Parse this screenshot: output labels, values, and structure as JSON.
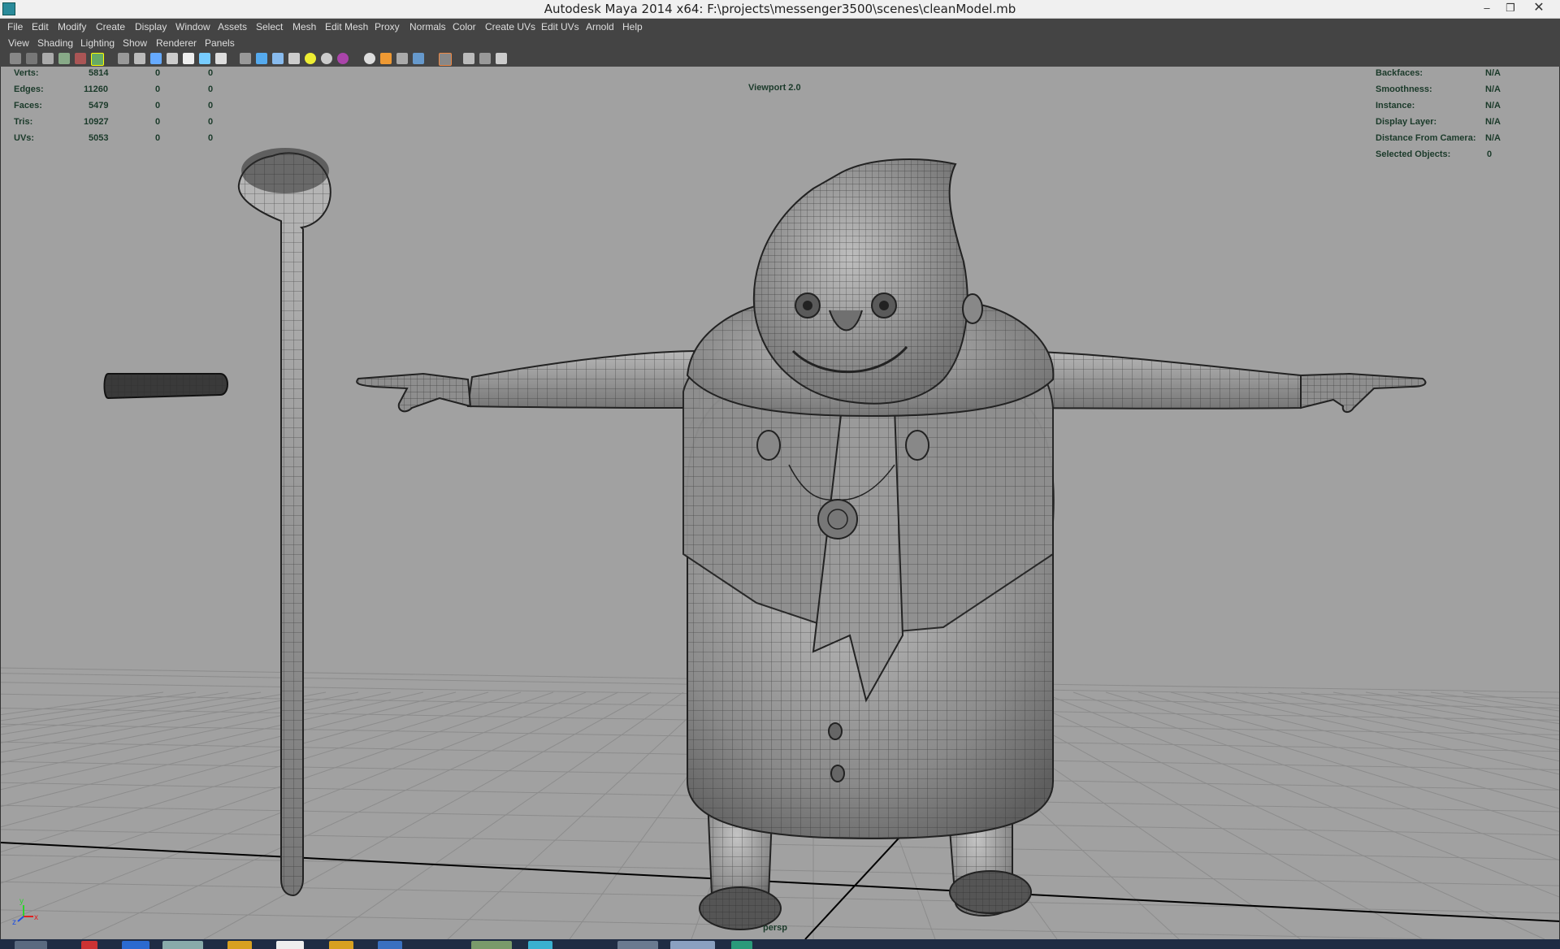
{
  "window": {
    "title": "Autodesk Maya 2014 x64: F:\\projects\\messenger3500\\scenes\\cleanModel.mb"
  },
  "menubar": [
    "File",
    "Edit",
    "Modify",
    "Create",
    "Display",
    "Window",
    "Assets",
    "Select",
    "Mesh",
    "Edit Mesh",
    "Proxy",
    "Normals",
    "Color",
    "Create UVs",
    "Edit UVs",
    "Arnold",
    "Help"
  ],
  "panel_menu": [
    "View",
    "Shading",
    "Lighting",
    "Show",
    "Renderer",
    "Panels"
  ],
  "hud_left": {
    "rows": [
      {
        "label": "Verts:",
        "values": [
          "5814",
          "0",
          "0"
        ]
      },
      {
        "label": "Edges:",
        "values": [
          "11260",
          "0",
          "0"
        ]
      },
      {
        "label": "Faces:",
        "values": [
          "5479",
          "0",
          "0"
        ]
      },
      {
        "label": "Tris:",
        "values": [
          "10927",
          "0",
          "0"
        ]
      },
      {
        "label": "UVs:",
        "values": [
          "5053",
          "0",
          "0"
        ]
      }
    ]
  },
  "hud_center": "Viewport 2.0",
  "hud_right": {
    "rows": [
      {
        "label": "Backfaces:",
        "value": "N/A"
      },
      {
        "label": "Smoothness:",
        "value": "N/A"
      },
      {
        "label": "Instance:",
        "value": "N/A"
      },
      {
        "label": "Display Layer:",
        "value": "N/A"
      },
      {
        "label": "Distance From Camera:",
        "value": "N/A"
      },
      {
        "label": "Selected Objects:",
        "value": "0"
      }
    ]
  },
  "camera_label": "persp",
  "axis_labels": {
    "x": "x",
    "y": "y",
    "z": "z"
  },
  "colors": {
    "viewport_bg": "#a1a1a1",
    "ui_bg": "#444444",
    "hud_text": "#1b3a2a",
    "grid_line": "#8c8c8c",
    "axis_line": "#000000"
  },
  "icons": [
    "select-tool-icon",
    "lasso-tool-icon",
    "paint-tool-icon",
    "move-icon",
    "rotate-icon",
    "scale-icon",
    "camera-icon",
    "grid-icon",
    "wireframe-icon",
    "smooth-shade-icon",
    "textured-icon",
    "light-icon",
    "shadow-icon",
    "isolate-icon",
    "xray-icon",
    "resolution-gate-icon",
    "film-gate-icon",
    "safe-action-icon"
  ]
}
